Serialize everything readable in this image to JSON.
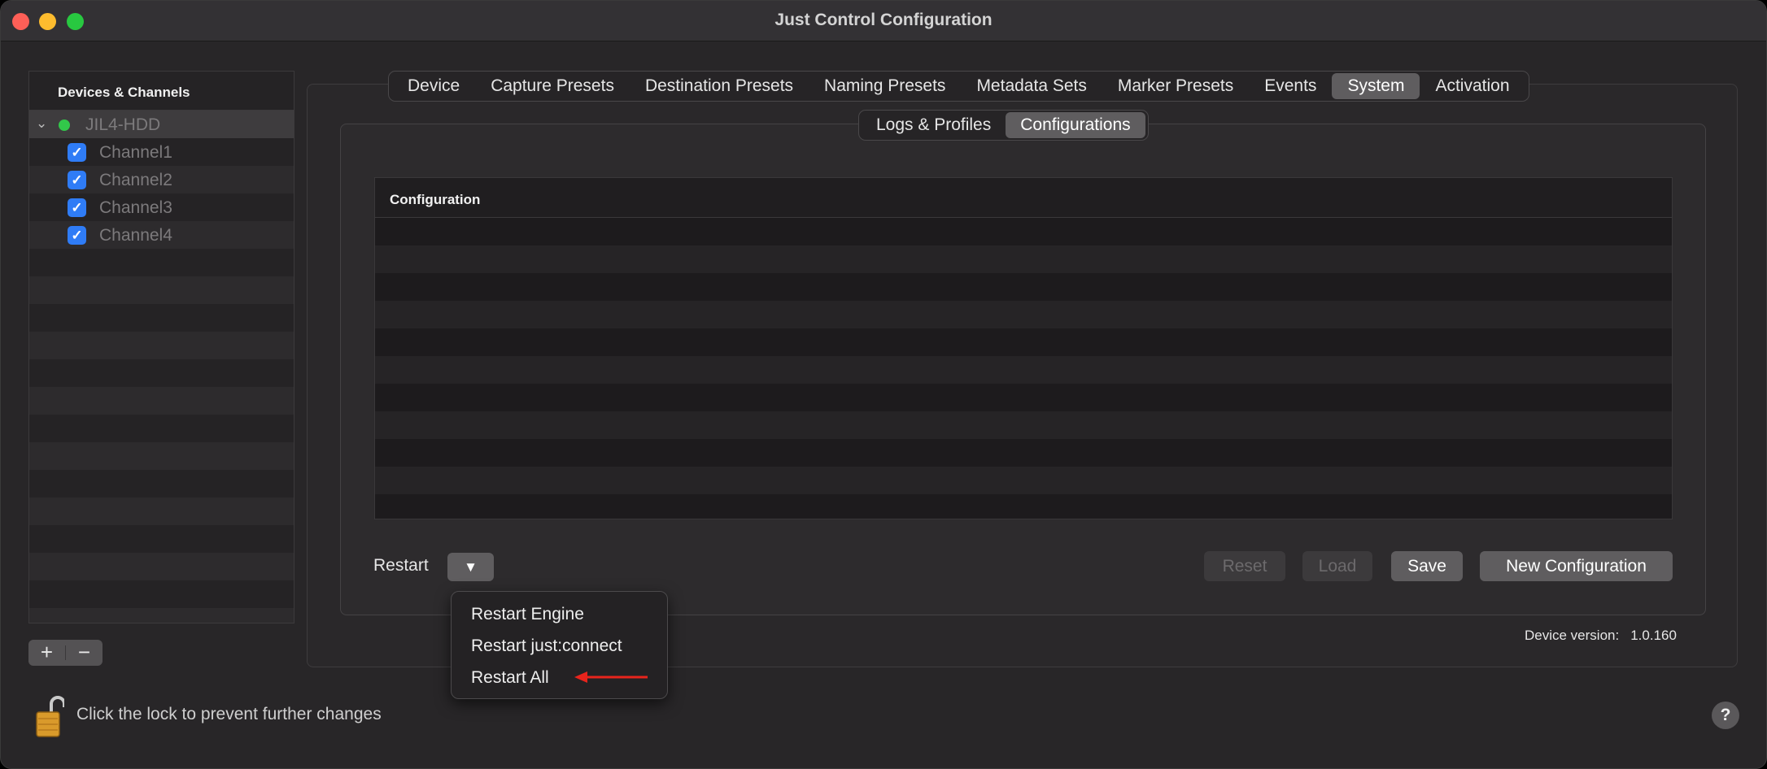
{
  "window": {
    "title": "Just Control Configuration"
  },
  "sidebar": {
    "header": "Devices & Channels",
    "device": {
      "name": "JIL4-HDD",
      "status_color": "#32c84a",
      "expanded": true
    },
    "channels": [
      {
        "label": "Channel1",
        "checked": true
      },
      {
        "label": "Channel2",
        "checked": true
      },
      {
        "label": "Channel3",
        "checked": true
      },
      {
        "label": "Channel4",
        "checked": true
      }
    ],
    "add_label": "+",
    "remove_label": "−"
  },
  "tabs": [
    "Device",
    "Capture Presets",
    "Destination Presets",
    "Naming Presets",
    "Metadata Sets",
    "Marker Presets",
    "Events",
    "System",
    "Activation"
  ],
  "active_tab": "System",
  "subtabs": [
    "Logs & Profiles",
    "Configurations"
  ],
  "active_subtab": "Configurations",
  "table": {
    "column_header": "Configuration",
    "rows": []
  },
  "controls": {
    "restart_label": "Restart",
    "restart_popup_glyph": "▼",
    "reset_label": "Reset",
    "load_label": "Load",
    "save_label": "Save",
    "new_configuration_label": "New Configuration"
  },
  "restart_menu": {
    "items": [
      "Restart Engine",
      "Restart just:connect",
      "Restart All"
    ],
    "highlighted_item": "Restart All",
    "arrow_color": "#e8241c"
  },
  "device_version": {
    "label": "Device version:",
    "value": "1.0.160"
  },
  "lock": {
    "text": "Click the lock to prevent further changes",
    "state": "unlocked",
    "icon": "open-padlock-icon"
  },
  "help": {
    "glyph": "?",
    "icon": "help-icon"
  }
}
